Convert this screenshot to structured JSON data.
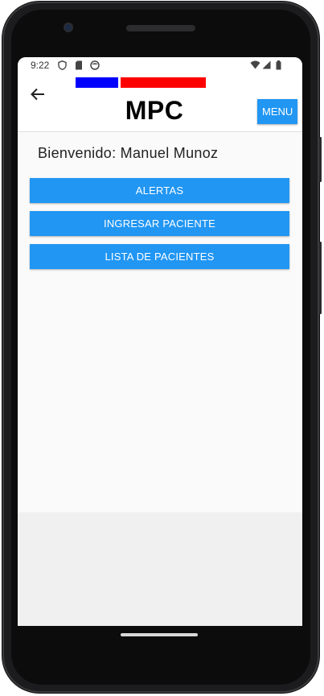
{
  "status_bar": {
    "time": "9:22",
    "left_icons": [
      "shield-icon",
      "sd-card-icon",
      "face-icon"
    ],
    "right_icons": [
      "wifi-icon",
      "signal-icon",
      "battery-icon"
    ]
  },
  "header": {
    "title": "MPC",
    "menu_label": "MENU",
    "flag_colors": [
      "#0000ff",
      "#ff0000"
    ]
  },
  "main": {
    "welcome_text": "Bienvenido: Manuel Munoz",
    "buttons": [
      {
        "label": "ALERTAS"
      },
      {
        "label": "INGRESAR PACIENTE"
      },
      {
        "label": "LISTA DE PACIENTES"
      }
    ]
  },
  "colors": {
    "accent": "#2196f3"
  }
}
